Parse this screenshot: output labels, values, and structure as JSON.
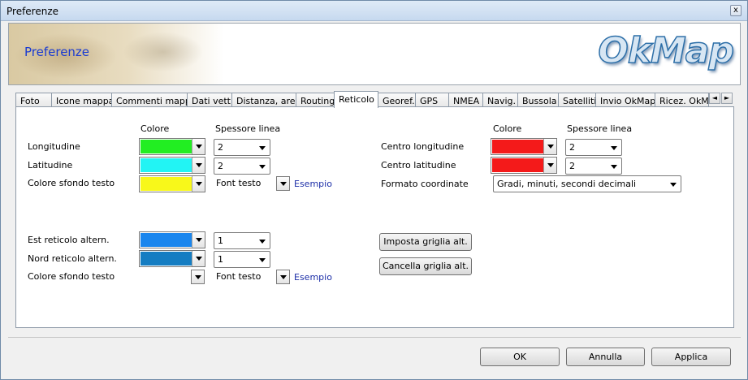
{
  "window": {
    "title": "Preferenze",
    "close_glyph": "x"
  },
  "header": {
    "title": "Preferenze",
    "logo": "OkMap"
  },
  "tabs": [
    "Foto",
    "Icone mappa",
    "Commenti mappa",
    "Dati vett.",
    "Distanza, area",
    "Routing",
    "Reticolo",
    "Georef.",
    "GPS",
    "NMEA",
    "Navig.",
    "Bussola",
    "Satelliti",
    "Invio OkMap",
    "Ricez. OkMa"
  ],
  "active_tab": "Reticolo",
  "left": {
    "col_colore": "Colore",
    "col_spessore": "Spessore linea",
    "rows": [
      {
        "label": "Longitudine",
        "color": "#22ee22",
        "thickness": "2"
      },
      {
        "label": "Latitudine",
        "color": "#22f4f4",
        "thickness": "2"
      }
    ],
    "bg_label": "Colore sfondo testo",
    "bg_color": "#f8f81a",
    "font_label": "Font testo",
    "example": "Esempio",
    "alt_rows": [
      {
        "label": "Est reticolo altern.",
        "color": "#1a86ee",
        "thickness": "1"
      },
      {
        "label": "Nord reticolo altern.",
        "color": "#157dc2",
        "thickness": "1"
      }
    ],
    "alt_bg_label": "Colore sfondo testo",
    "alt_font_label": "Font testo",
    "alt_example": "Esempio"
  },
  "right": {
    "col_colore": "Colore",
    "col_spessore": "Spessore linea",
    "rows": [
      {
        "label": "Centro longitudine",
        "color": "#f41a1a",
        "thickness": "2"
      },
      {
        "label": "Centro latitudine",
        "color": "#f41a1a",
        "thickness": "2"
      }
    ],
    "format_label": "Formato coordinate",
    "format_value": "Gradi, minuti, secondi decimali",
    "btn_set": "Imposta griglia alt.",
    "btn_clear": "Cancella griglia alt."
  },
  "footer": {
    "ok": "OK",
    "cancel": "Annulla",
    "apply": "Applica"
  },
  "icons": {
    "tab_left": "◄",
    "tab_right": "►"
  }
}
